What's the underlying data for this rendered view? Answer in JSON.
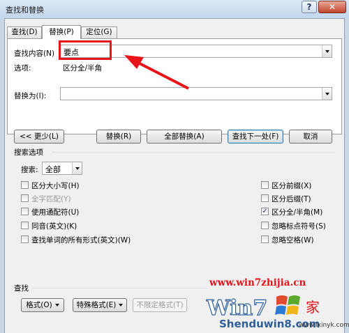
{
  "window": {
    "title": "查找和替换",
    "help_label": "?",
    "close_label": "✕"
  },
  "tabs": [
    {
      "label": "查找(D)"
    },
    {
      "label": "替换(P)"
    },
    {
      "label": "定位(G)"
    }
  ],
  "find": {
    "label": "查找内容(N)",
    "value": "要点"
  },
  "options": {
    "label": "选项:",
    "value": "区分全/半角"
  },
  "replace": {
    "label": "替换为(I):",
    "value": ""
  },
  "buttons": {
    "less": "<< 更少(L)",
    "replace": "替换(R)",
    "replace_all": "全部替换(A)",
    "find_next": "查找下一处(F)",
    "cancel": "取消"
  },
  "search_options": {
    "title": "搜索选项",
    "search_label": "搜索:",
    "search_value": "全部",
    "left": [
      {
        "label": "区分大小写(H)",
        "checked": false,
        "enabled": true
      },
      {
        "label": "全字匹配(Y)",
        "checked": false,
        "enabled": false
      },
      {
        "label": "使用通配符(U)",
        "checked": false,
        "enabled": true
      },
      {
        "label": "同音(英文)(K)",
        "checked": false,
        "enabled": true
      },
      {
        "label": "查找单词的所有形式(英文)(W)",
        "checked": false,
        "enabled": true
      }
    ],
    "right": [
      {
        "label": "区分前缀(X)",
        "checked": false,
        "enabled": true
      },
      {
        "label": "区分后缀(T)",
        "checked": false,
        "enabled": true
      },
      {
        "label": "区分全/半角(M)",
        "checked": true,
        "enabled": true
      },
      {
        "label": "忽略标点符号(S)",
        "checked": false,
        "enabled": true
      },
      {
        "label": "忽略空格(W)",
        "checked": false,
        "enabled": true
      }
    ]
  },
  "find_section": {
    "title": "查找",
    "format": "格式(O)",
    "special": "特殊格式(E)",
    "no_format": "不限定格式(T)"
  },
  "watermark": {
    "url": "www.win7zhijia.cn",
    "logo_text": "Shenduwin8.com",
    "site": "www.lxinyk.com"
  },
  "colors": {
    "annotation": "#e8141a",
    "watermark": "#e0141a"
  }
}
